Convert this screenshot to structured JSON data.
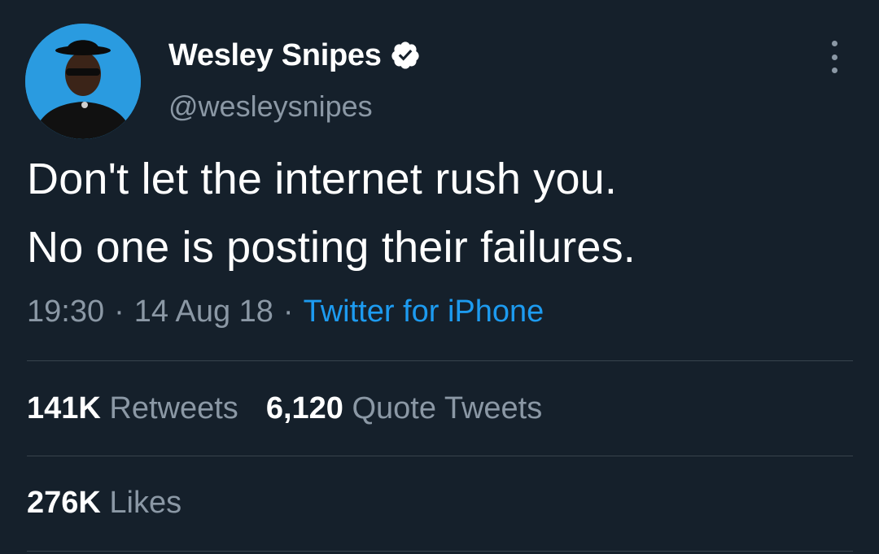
{
  "author": {
    "display_name": "Wesley Snipes",
    "handle": "@wesleysnipes",
    "verified": true,
    "avatar_icon": "profile-photo"
  },
  "tweet": {
    "lines": [
      "Don't let the internet rush you.",
      "No one is posting their failures."
    ],
    "time": "19:30",
    "date": "14 Aug 18",
    "separator": "·",
    "source": "Twitter for iPhone"
  },
  "stats": {
    "retweets_count": "141K",
    "retweets_label": "Retweets",
    "quotes_count": "6,120",
    "quotes_label": "Quote Tweets",
    "likes_count": "276K",
    "likes_label": "Likes"
  },
  "icons": {
    "verified": "verified-badge-icon",
    "more": "more-options-icon"
  },
  "colors": {
    "background": "#15202b",
    "text": "#ffffff",
    "secondary_text": "#8b98a5",
    "link": "#1d9bf0",
    "divider": "#38444d"
  }
}
